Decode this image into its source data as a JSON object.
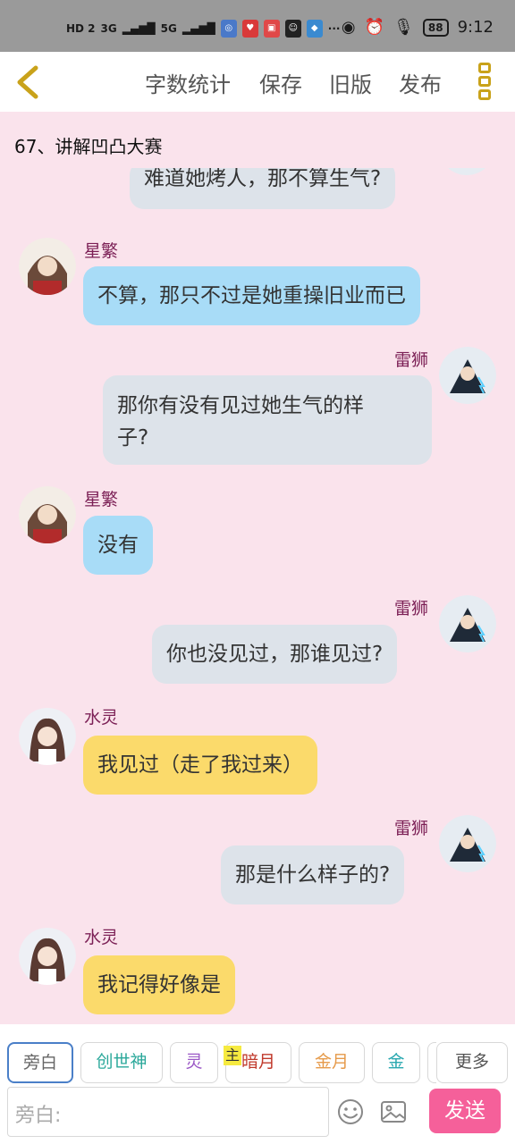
{
  "status_bar": {
    "network": "HD 2",
    "signal1": "3G",
    "signal2": "5G",
    "battery": "88",
    "time": "9:12",
    "more_dots": "···"
  },
  "toolbar": {
    "word_count": "字数统计",
    "save": "保存",
    "old_version": "旧版",
    "publish": "发布"
  },
  "chapter_title": "67、讲解凹凸大赛",
  "messages": [
    {
      "side": "right",
      "name": "",
      "text": "难道她烤人，那不算生气?",
      "color": "gray"
    },
    {
      "side": "left",
      "name": "星繁",
      "text": "不算，那只不过是她重操旧业而已",
      "color": "blue"
    },
    {
      "side": "right",
      "name": "雷狮",
      "text": "那你有没有见过她生气的样子?",
      "line1": "那你有没有见过她生气的样",
      "line2": "子?",
      "color": "gray"
    },
    {
      "side": "left",
      "name": "星繁",
      "text": "没有",
      "color": "blue"
    },
    {
      "side": "right",
      "name": "雷狮",
      "text": "你也没见过，那谁见过?",
      "color": "gray"
    },
    {
      "side": "left",
      "name": "水灵",
      "text": "我见过（走了我过来）",
      "color": "yellow"
    },
    {
      "side": "right",
      "name": "雷狮",
      "text": "那是什么样子的?",
      "color": "gray"
    },
    {
      "side": "left",
      "name": "水灵",
      "text": "我记得好像是",
      "color": "yellow"
    }
  ],
  "roles": [
    {
      "label": "旁白",
      "color": "#666666"
    },
    {
      "label": "创世神",
      "color": "#2aa89a"
    },
    {
      "label": "灵",
      "color": "#9b59c6"
    },
    {
      "label": "暗月",
      "color": "#c0392b"
    },
    {
      "label": "金月",
      "color": "#e69a4a"
    },
    {
      "label": "金",
      "color": "#2aa8b0"
    },
    {
      "label": "更多",
      "color": "#555555"
    }
  ],
  "main_badge": "主",
  "input": {
    "placeholder": "旁白:"
  },
  "send_label": "发送",
  "colors": {
    "accent_pink": "#f5609a",
    "name_color": "#7b1f55",
    "bubble_blue": "#a8dcf7",
    "bubble_gray": "#dde3ea",
    "bubble_yellow": "#fbda6b",
    "background": "#fae3ec"
  }
}
